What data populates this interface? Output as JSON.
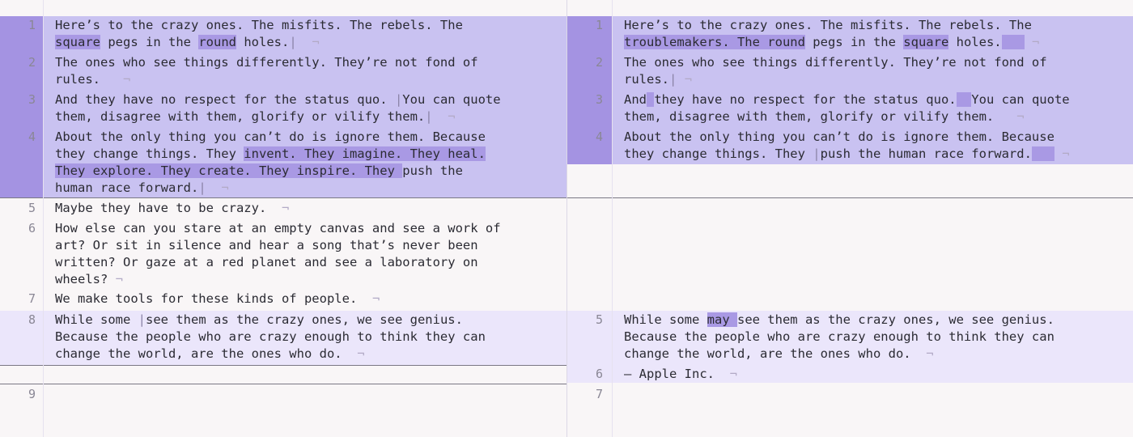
{
  "left": {
    "lines": [
      {
        "num": "1",
        "text": "Here’s to the crazy ones. The misfits. The rebels. The\nsquare pegs in the round holes.|  ¬"
      },
      {
        "num": "2",
        "text": "The ones who see things differently. They’re not fond of\nrules.   ¬"
      },
      {
        "num": "3",
        "text": "And they have no respect for the status quo. |You can quote\nthem, disagree with them, glorify or vilify them.|  ¬"
      },
      {
        "num": "4",
        "text": "About the only thing you can’t do is ignore them. Because\nthey change things. They invent. They imagine. They heal.\nThey explore. They create. They inspire. They push the\nhuman race forward.|  ¬"
      },
      {
        "num": "5",
        "text": "Maybe they have to be crazy.  ¬"
      },
      {
        "num": "6",
        "text": "How else can you stare at an empty canvas and see a work of\nart? Or sit in silence and hear a song that’s never been\nwritten? Or gaze at a red planet and see a laboratory on\nwheels? ¬"
      },
      {
        "num": "7",
        "text": "We make tools for these kinds of people.  ¬"
      },
      {
        "num": "8",
        "text": "While some |see them as the crazy ones, we see genius.\nBecause the people who are crazy enough to think they can\nchange the world, are the ones who do.  ¬"
      },
      {
        "num": "9",
        "text": ""
      }
    ]
  },
  "right": {
    "lines": [
      {
        "num": "1",
        "text": "Here’s to the crazy ones. The misfits. The rebels. The\ntroublemakers. The round pegs in the square holes.    ¬"
      },
      {
        "num": "2",
        "text": "The ones who see things differently. They’re not fond of\nrules.| ¬"
      },
      {
        "num": "3",
        "text": "And they have no respect for the status quo.  You can quote\nthem, disagree with them, glorify or vilify them.   ¬"
      },
      {
        "num": "4",
        "text": "About the only thing you can’t do is ignore them. Because\nthey change things. They |push the human race forward.    ¬"
      },
      {
        "num": "5",
        "text": "While some may see them as the crazy ones, we see genius.\nBecause the people who are crazy enough to think they can\nchange the world, are the ones who do.  ¬"
      },
      {
        "num": "6",
        "text": "— Apple Inc.  ¬"
      },
      {
        "num": "7",
        "text": ""
      }
    ]
  },
  "colors": {
    "changed_band": "#c9c2f1",
    "changed_gutter": "#a493e2",
    "word_highlight": "#a999e4",
    "modified_band": "#ebe6fb",
    "background": "#f9f6f7",
    "text": "#2b2b33",
    "line_number": "#8a8795"
  }
}
